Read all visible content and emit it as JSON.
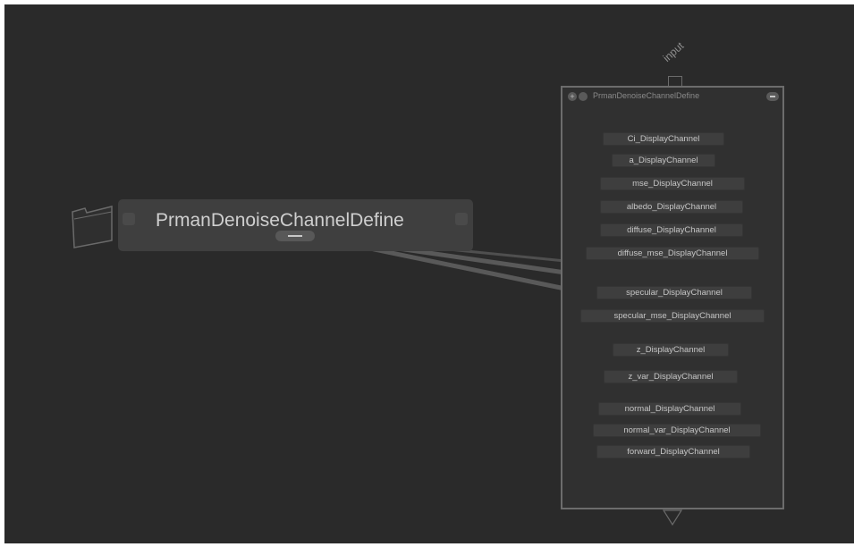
{
  "collapsed_node": {
    "title": "PrmanDenoiseChannelDefine"
  },
  "expanded_node": {
    "input_label": "input",
    "title": "PrmanDenoiseChannelDefine",
    "add_symbol": "+",
    "channels": [
      "Ci_DisplayChannel",
      "a_DisplayChannel",
      "mse_DisplayChannel",
      "albedo_DisplayChannel",
      "diffuse_DisplayChannel",
      "diffuse_mse_DisplayChannel",
      "specular_DisplayChannel",
      "specular_mse_DisplayChannel",
      "z_DisplayChannel",
      "z_var_DisplayChannel",
      "normal_DisplayChannel",
      "normal_var_DisplayChannel",
      "forward_DisplayChannel"
    ]
  },
  "colors": {
    "canvas": "#2a2a2a",
    "node": "#3f3f3f",
    "wire": "#595959"
  }
}
